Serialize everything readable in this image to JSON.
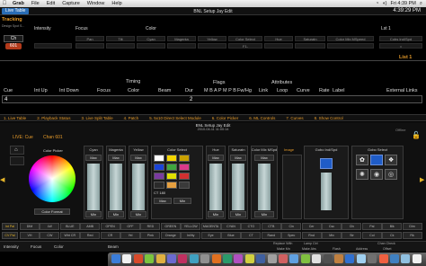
{
  "menubar": {
    "app": "Grab",
    "items": [
      "File",
      "Edit",
      "Capture",
      "Window",
      "Help"
    ],
    "clock": "Fri 4:39 PM"
  },
  "titlebar": {
    "tab": "Live Table",
    "title": "BNL Setup Jay Edit",
    "clock": "4:39:29 PM"
  },
  "tracking": {
    "title": "Tracking",
    "channel_label": "Ch",
    "channel_value": "601",
    "subtitle": "Design Spot S...",
    "groups": [
      "Intensity",
      "Focus",
      "Color",
      "Lst 1"
    ],
    "columns": [
      "Pan",
      "Tilt",
      "Cyan",
      "Magenta",
      "Yellow",
      "Color Select",
      "Hue",
      "Saturatn",
      "Color Mix MSpeed",
      "Cobs Ind/Spd"
    ],
    "row_values": [
      "",
      "",
      "",
      "",
      "",
      "F1-",
      "",
      "",
      "",
      "="
    ]
  },
  "cues": {
    "list_label": "List 1",
    "headers": [
      "Cue",
      "Int Up",
      "Int Down",
      "Focus",
      "Color",
      "Beam",
      "Dur",
      "M B A P M P B",
      "Fw/Hg",
      "Link",
      "Loop",
      "Curve",
      "Rate",
      "Label",
      "External Links"
    ],
    "group_headers": [
      "Timing",
      "Flags",
      "Attributes"
    ],
    "row": {
      "cue": "4",
      "dur": "2"
    }
  },
  "tabs": [
    "1. Live Table",
    "2. Playback Status",
    "3. Live Split Table",
    "4. Patch",
    "5. 5x10 Direct Select Module",
    "6. Color Picker",
    "6. ML Controls",
    "7. Curves",
    "8. Show Control"
  ],
  "sheet": {
    "title": "BNL Setup Jay Edit",
    "subtitle": "2010-04-11 11:00:14",
    "live_cue": "LIVE: Cue",
    "chan": "Chan 601",
    "offline": "Offline",
    "ml_label": "Image",
    "color_picker": "Color Picker",
    "color_format": "Color Format",
    "fader_names": [
      "Cyan",
      "Magenta",
      "Yellow",
      "Color Select",
      "Hue",
      "Saturatn",
      "Color Mix MSpd"
    ],
    "max": "Max",
    "min": "Min",
    "gobo_panel": "Gobo Ind/Spd",
    "gobo_select": "Gobo Select",
    "cto_label": "CT 180"
  },
  "palettes": {
    "int_pal": "Int Pal",
    "cv_pal": "CV Pal",
    "row1": [
      "DIM",
      "LW",
      "BLUE",
      "AMB",
      "OPEN",
      "OFF",
      "RED",
      "GREEN",
      "YELLOW",
      "MAGENTA",
      "CYAN",
      "CTO",
      "CTB",
      "Cin",
      "Cer",
      "Csc",
      "Cfx",
      "Pal",
      "Blk",
      "Dim"
    ],
    "row2": [
      "VH",
      "CW",
      "Wht CR",
      "Red",
      "CR",
      "Yel",
      "Pink",
      "Orange",
      "Inl/ity",
      "Eye",
      "Blue",
      "CT",
      "Rand",
      "Spec",
      "Rnd",
      "Mix",
      "Str",
      "Col",
      "Ck",
      "Rk"
    ]
  },
  "softkeys": {
    "bottom": [
      "Intensity",
      "Focus",
      "Color",
      "Beam"
    ],
    "right": [
      "Replace With",
      "Lamp Ctrl",
      "Make Mn",
      "Make Abs",
      "Flash",
      "Address",
      "Offset",
      "Chan Check"
    ]
  }
}
